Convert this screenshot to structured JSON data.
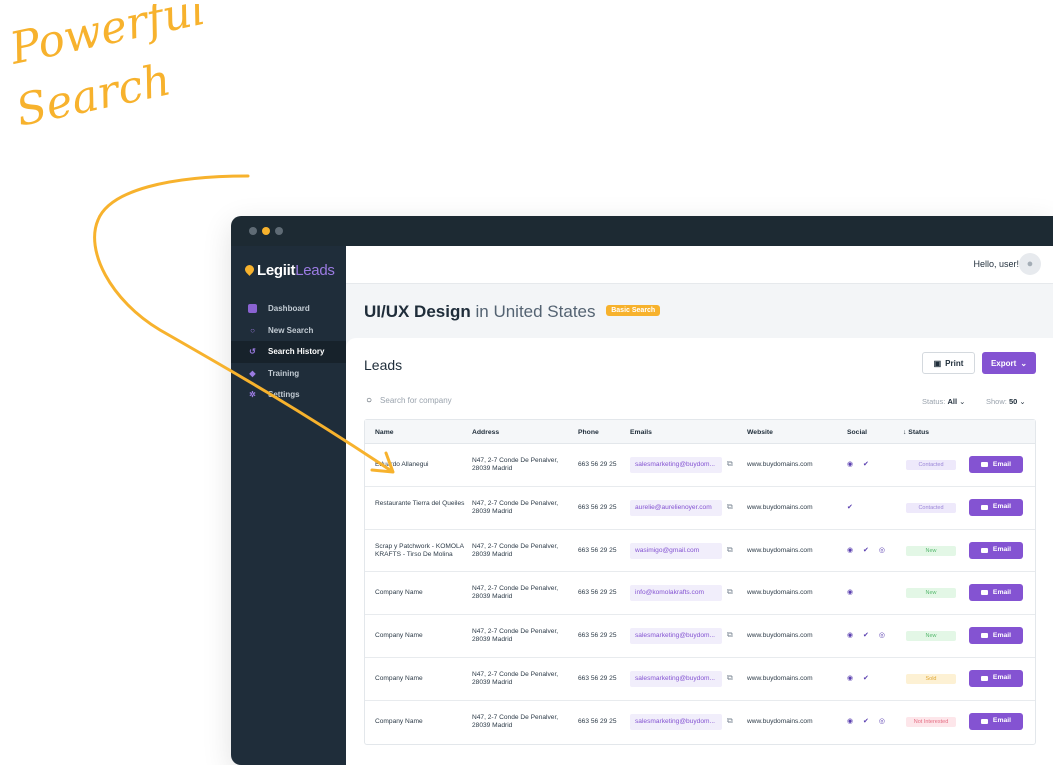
{
  "decor": {
    "line1": "Powerful",
    "line2": "Search"
  },
  "colors": {
    "accent": "#8453d2",
    "brand_yellow": "#f7b22d",
    "sidebar_bg": "#1f2d3a"
  },
  "app": {
    "logo_main": "Legiit",
    "logo_accent": "Leads"
  },
  "sidebar": {
    "items": [
      {
        "label": "Dashboard",
        "icon": "dashboard-icon"
      },
      {
        "label": "New Search",
        "icon": "search-icon"
      },
      {
        "label": "Search History",
        "icon": "history-icon",
        "active": true
      },
      {
        "label": "Training",
        "icon": "graduation-cap-icon"
      },
      {
        "label": "Settings",
        "icon": "gear-icon"
      }
    ]
  },
  "topbar": {
    "greeting": "Hello, user!",
    "avatar_icon": "user-icon"
  },
  "page": {
    "title_bold": "UI/UX Design",
    "title_rest": "in United States",
    "badge": "Basic Search"
  },
  "leads": {
    "title": "Leads",
    "print_label": "Print",
    "export_label": "Export",
    "search_placeholder": "Search for company",
    "status_label": "Status:",
    "status_value": "All",
    "show_label": "Show:",
    "show_value": "50",
    "columns": [
      "Name",
      "Address",
      "Phone",
      "Emails",
      "Website",
      "Social",
      "Status"
    ],
    "rows": [
      {
        "name": "Eduardo Allanegui",
        "address": "N47, 2-7 Conde De Penalver, 28039 Madrid",
        "phone": "663 56 29 25",
        "email": "salesmarketing@buydom...",
        "website": "www.buydomains.com",
        "social": "◉ ✔",
        "status": "Contacted",
        "status_class": "st-contacted",
        "button": "Email"
      },
      {
        "name": "Restaurante Tierra del Queiles",
        "address": "N47, 2-7 Conde De Penalver, 28039 Madrid",
        "phone": "663 56 29 25",
        "email": "aurelie@aurelienoyer.com",
        "website": "www.buydomains.com",
        "social": "✔",
        "status": "Contacted",
        "status_class": "st-contacted",
        "button": "Email"
      },
      {
        "name": "Scrap y Patchwork - KOMOLA KRAFTS - Tirso De Molina",
        "address": "N47, 2-7 Conde De Penalver, 28039 Madrid",
        "phone": "663 56 29 25",
        "email": "wasimigo@gmail.com",
        "website": "www.buydomains.com",
        "social": "◉ ✔ ◎",
        "status": "New",
        "status_class": "st-new",
        "button": "Email"
      },
      {
        "name": "Company Name",
        "address": "N47, 2-7 Conde De Penalver, 28039 Madrid",
        "phone": "663 56 29 25",
        "email": "info@komolakrafts.com",
        "website": "www.buydomains.com",
        "social": "◉",
        "status": "New",
        "status_class": "st-new",
        "button": "Email"
      },
      {
        "name": "Company Name",
        "address": "N47, 2-7 Conde De Penalver, 28039 Madrid",
        "phone": "663 56 29 25",
        "email": "salesmarketing@buydom...",
        "website": "www.buydomains.com",
        "social": "◉ ✔ ◎",
        "status": "New",
        "status_class": "st-new",
        "button": "Email"
      },
      {
        "name": "Company Name",
        "address": "N47, 2-7 Conde De Penalver, 28039 Madrid",
        "phone": "663 56 29 25",
        "email": "salesmarketing@buydom...",
        "website": "www.buydomains.com",
        "social": "◉ ✔",
        "status": "Sold",
        "status_class": "st-sold",
        "button": "Email"
      },
      {
        "name": "Company Name",
        "address": "N47, 2-7 Conde De Penalver, 28039 Madrid",
        "phone": "663 56 29 25",
        "email": "salesmarketing@buydom...",
        "website": "www.buydomains.com",
        "social": "◉ ✔ ◎",
        "status": "Not Interested",
        "status_class": "st-ni",
        "button": "Email"
      }
    ]
  }
}
